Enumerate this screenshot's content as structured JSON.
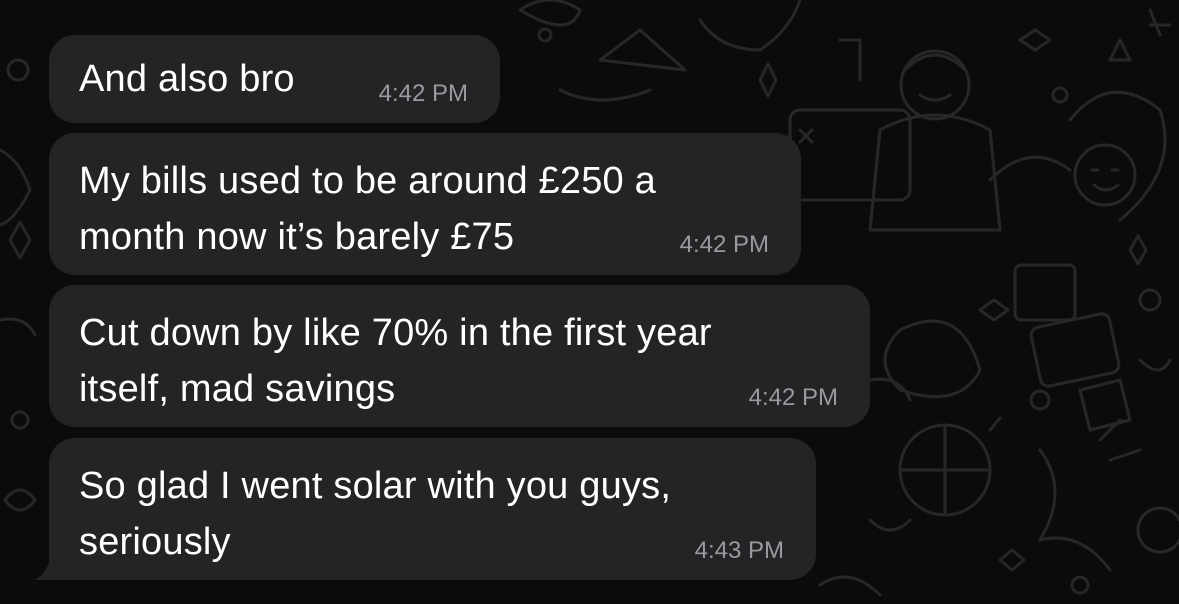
{
  "messages": [
    {
      "lines": [
        "And also bro"
      ],
      "time": "4:42 PM"
    },
    {
      "lines": [
        "My bills used to be around £250 a",
        "month now it’s barely £75"
      ],
      "time": "4:42 PM"
    },
    {
      "lines": [
        "Cut down by like 70% in the first year",
        "itself, mad savings"
      ],
      "time": "4:42 PM"
    },
    {
      "lines": [
        "So glad I went solar with you guys,",
        "seriously"
      ],
      "time": "4:43 PM"
    }
  ],
  "colors": {
    "background": "#0b0b0c",
    "bubble": "#242426",
    "text": "#ffffff",
    "timestamp": "#9a9a9e",
    "wallpaper_lines": "#2a2a2d"
  }
}
